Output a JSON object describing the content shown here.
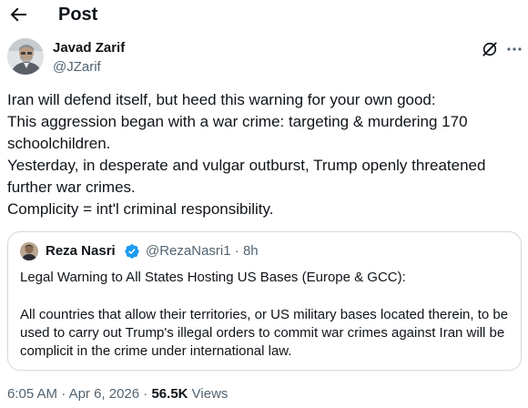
{
  "header": {
    "title": "Post"
  },
  "author": {
    "name": "Javad Zarif",
    "handle": "@JZarif"
  },
  "post": {
    "lines": [
      "Iran will defend itself, but heed this warning for your own good:",
      "This aggression began with a war crime: targeting & murdering 170",
      "schoolchildren.",
      "Yesterday, in desperate and vulgar outburst, Trump openly threatened",
      "further war crimes.",
      "Complicity = int'l criminal responsibility."
    ]
  },
  "quote": {
    "name": "Reza Nasri",
    "handle": "@RezaNasri1",
    "separator": "·",
    "age": "8h",
    "paragraphs": [
      "Legal Warning to All States Hosting US Bases (Europe & GCC):",
      "All countries that allow their territories, or US military bases located therein, to be used to carry out Trump's illegal orders to commit war crimes against Iran will be complicit in the crime under international law."
    ]
  },
  "meta": {
    "time": "6:05 AM",
    "separator": "·",
    "date": "Apr 6, 2026",
    "views_count": "56.5K",
    "views_label": "Views"
  },
  "icons": {
    "back": "arrow-left-icon",
    "grok": "grok-icon",
    "more": "more-icon",
    "verified": "verified-badge-icon"
  },
  "colors": {
    "text": "#0f1419",
    "secondary": "#536471",
    "border": "#cfd9de",
    "verified": "#1d9bf0"
  }
}
